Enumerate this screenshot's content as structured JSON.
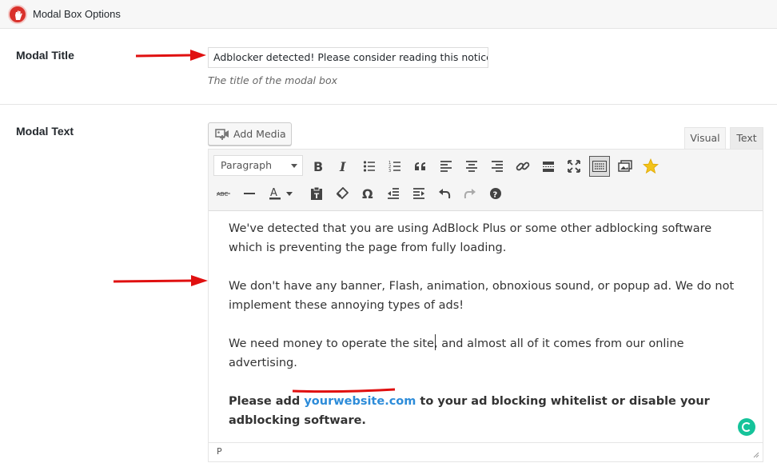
{
  "header": {
    "title": "Modal Box Options",
    "logo_icon": "stop-hand-icon"
  },
  "modal_title": {
    "label": "Modal Title",
    "value": "Adblocker detected! Please consider reading this notice.",
    "description": "The title of the modal box"
  },
  "modal_text": {
    "label": "Modal Text",
    "add_media_label": "Add Media",
    "tabs": {
      "visual": "Visual",
      "text": "Text",
      "active": "Visual"
    },
    "format_select": "Paragraph",
    "toolbar_row1": [
      "bold-icon",
      "italic-icon",
      "bullet-list-icon",
      "numbered-list-icon",
      "blockquote-icon",
      "align-left-icon",
      "align-center-icon",
      "align-right-icon",
      "link-icon",
      "read-more-icon",
      "fullscreen-icon",
      "toolbar-toggle-icon",
      "insert-media-icon",
      "star-icon"
    ],
    "toolbar_row2": [
      "strikethrough-icon",
      "horizontal-line-icon",
      "text-color-icon",
      "paste-text-icon",
      "clear-formatting-icon",
      "special-character-icon",
      "outdent-icon",
      "indent-icon",
      "undo-icon",
      "redo-icon",
      "help-icon"
    ],
    "paragraphs": [
      "We've detected that you are using AdBlock Plus or some other adblocking software which is preventing the page from fully loading.",
      "We don't have any banner, Flash, animation, obnoxious sound, or popup ad. We do not implement these annoying types of ads!",
      "We need money to operate the site, and almost all of it comes from our online advertising."
    ],
    "bold_paragraph": {
      "before": "Please add ",
      "link": "yourwebsite.com",
      "after": " to your ad blocking whitelist or disable your adblocking software."
    },
    "status_path": "P"
  },
  "colors": {
    "arrow": "#e01010",
    "link": "#2d8cd9",
    "grammarly": "#15c39a",
    "logo": "#d9312b"
  }
}
